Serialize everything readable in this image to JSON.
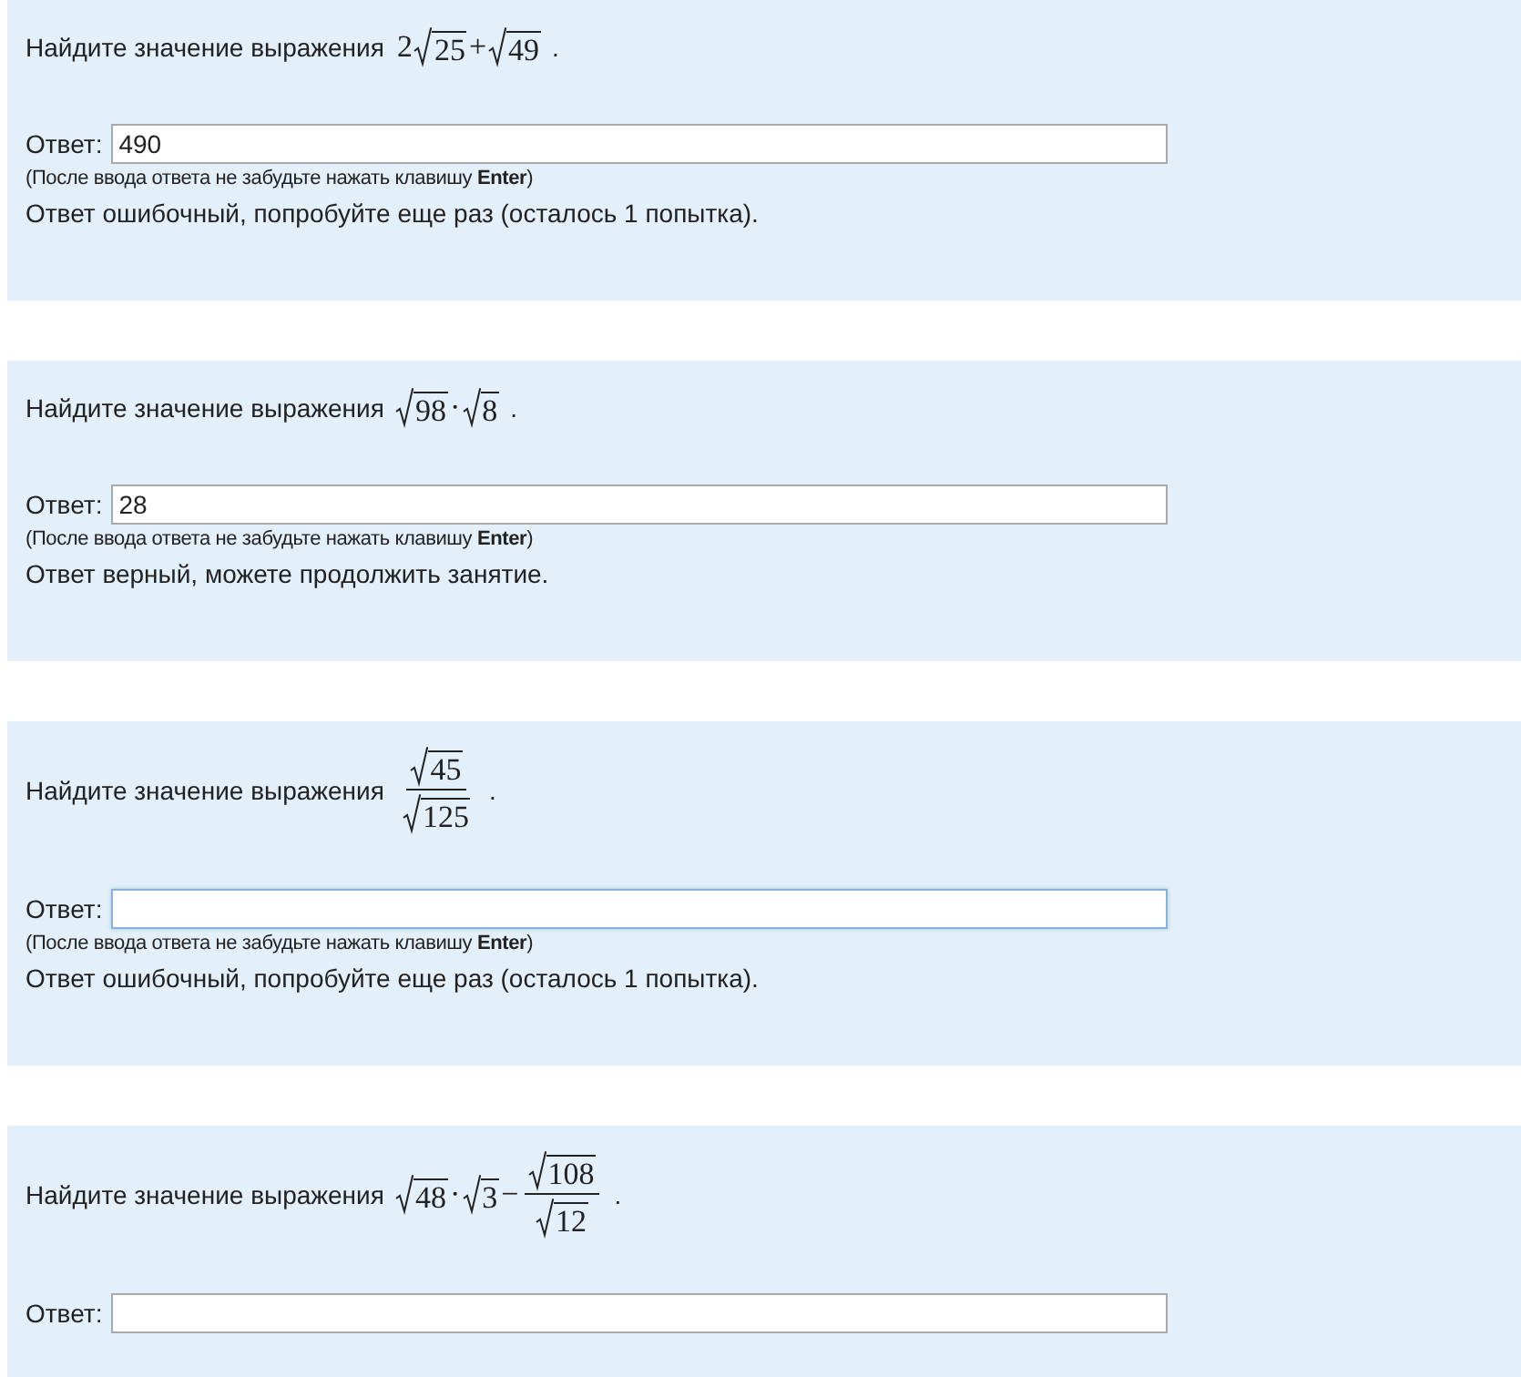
{
  "tasks": [
    {
      "question": "Найдите значение выражения",
      "expression": [
        {
          "kind": "text",
          "text": "2"
        },
        {
          "kind": "sqrt",
          "text": "25"
        },
        {
          "kind": "text",
          "text": "+"
        },
        {
          "kind": "sqrt",
          "text": "49"
        }
      ],
      "end": ".",
      "answer_label": "Ответ:",
      "answer": {
        "value": "490",
        "focused": false
      },
      "hint": "(После ввода ответа не забудьте нажать клавишу **Enter**)",
      "result": "Ответ ошибочный, попробуйте еще раз (осталось 1 попытка)."
    },
    {
      "question": "Найдите значение выражения",
      "expression": [
        {
          "kind": "sqrt",
          "text": "98"
        },
        {
          "kind": "text",
          "text": "·"
        },
        {
          "kind": "sqrt",
          "text": "8"
        }
      ],
      "end": ".",
      "answer_label": "Ответ:",
      "answer": {
        "value": "28",
        "focused": false
      },
      "hint": "(После ввода ответа не забудьте нажать клавишу **Enter**)",
      "result": "Ответ верный, можете продолжить занятие."
    },
    {
      "question": "Найдите значение выражения",
      "expression": [
        {
          "kind": "frac",
          "num": [
            {
              "kind": "sqrt",
              "text": "45"
            }
          ],
          "den": [
            {
              "kind": "sqrt",
              "text": "125"
            }
          ]
        }
      ],
      "end": ".",
      "answer_label": "Ответ:",
      "answer": {
        "focused": true
      },
      "hint": "(После ввода ответа не забудьте нажать клавишу **Enter**)",
      "result": "Ответ ошибочный, попробуйте еще раз (осталось 1 попытка)."
    },
    {
      "question": "Найдите значение выражения",
      "expression": [
        {
          "kind": "sqrt",
          "text": "48"
        },
        {
          "kind": "text",
          "text": "·"
        },
        {
          "kind": "sqrt",
          "text": "3"
        },
        {
          "kind": "text",
          "text": "−"
        },
        {
          "kind": "frac",
          "num": [
            {
              "kind": "sqrt",
              "text": "108"
            }
          ],
          "den": [
            {
              "kind": "sqrt",
              "text": "12"
            }
          ]
        }
      ],
      "end": ".",
      "answer_label": "Ответ:",
      "answer": {
        "focused": false
      }
    }
  ]
}
